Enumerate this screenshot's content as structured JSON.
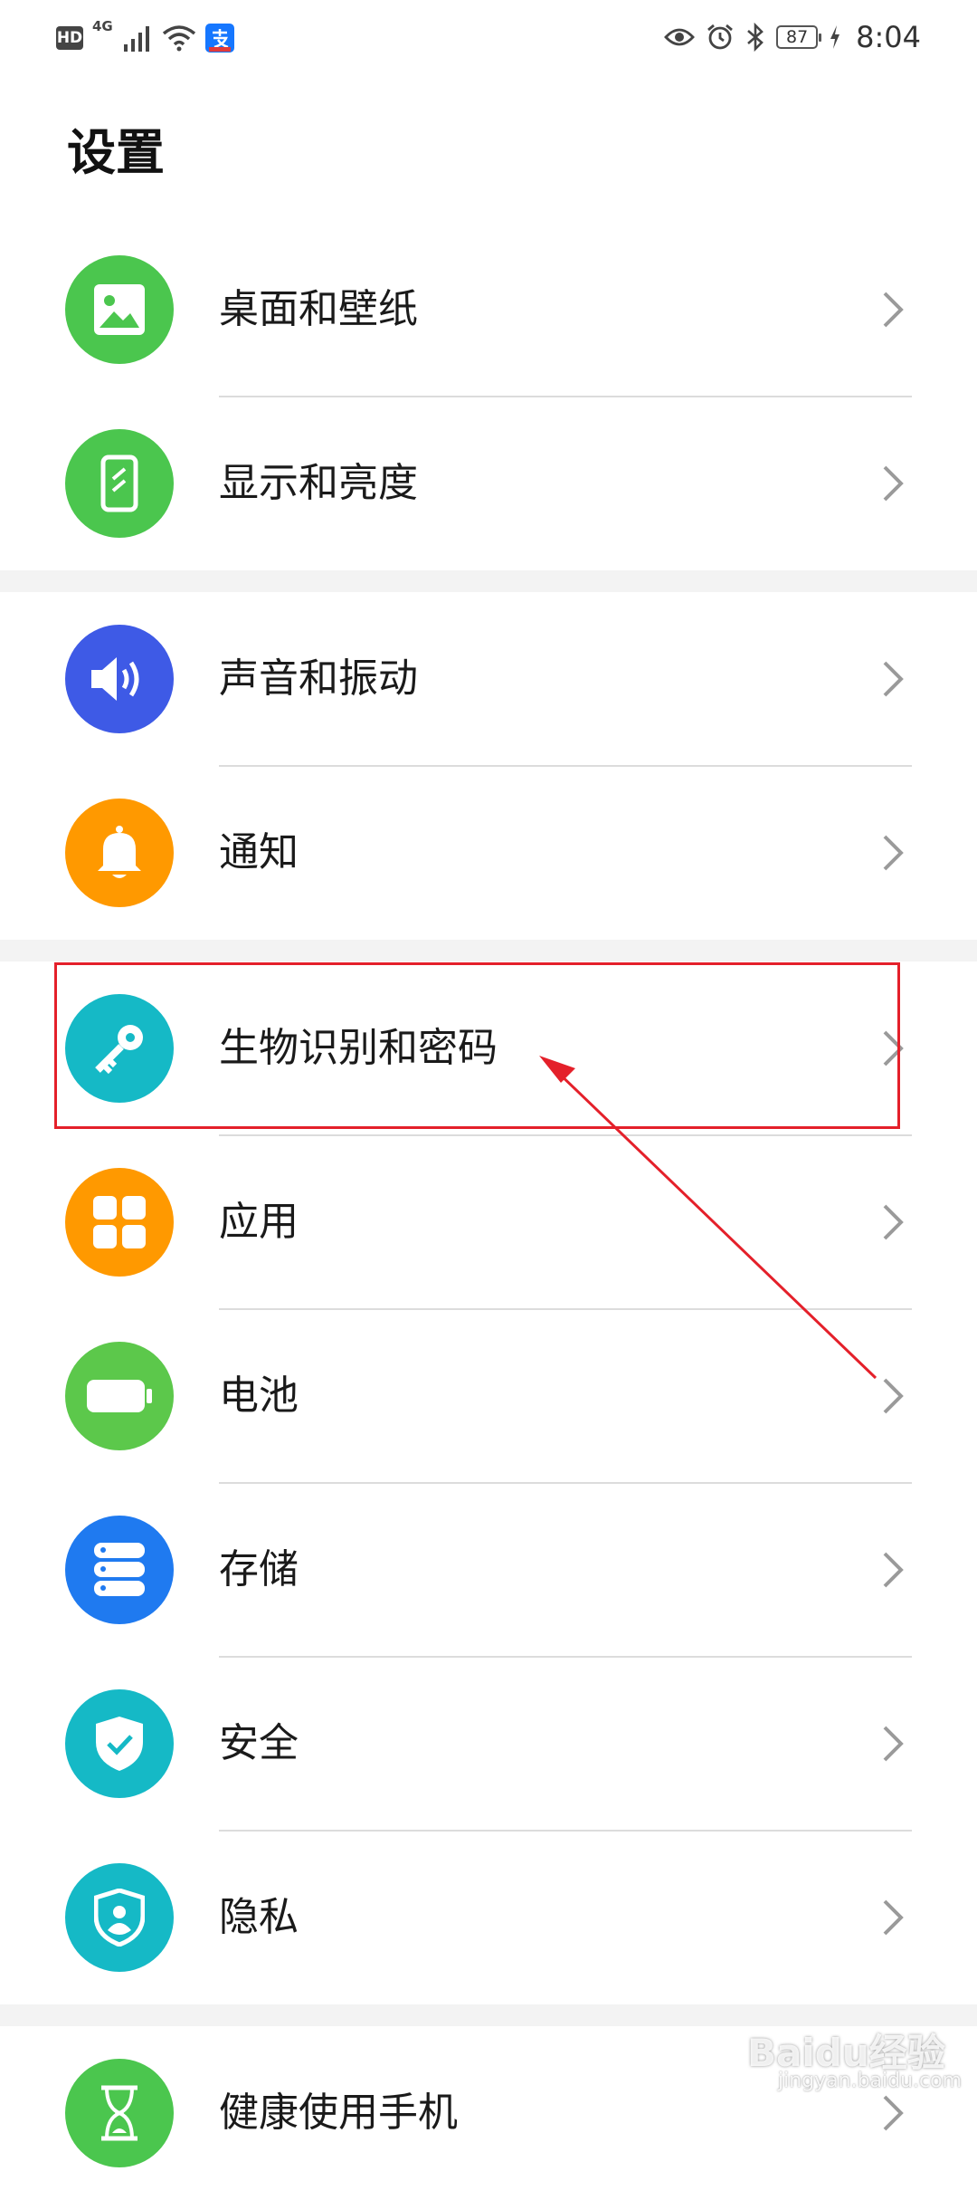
{
  "status_bar": {
    "hd": "HD",
    "network": "4G",
    "battery": "87",
    "time": "8:04"
  },
  "page_title": "设置",
  "items": [
    {
      "label": "桌面和壁纸",
      "icon": "wallpaper-icon",
      "color": "#4bc64e"
    },
    {
      "label": "显示和亮度",
      "icon": "display-icon",
      "color": "#4bc64e"
    },
    {
      "label": "声音和振动",
      "icon": "sound-icon",
      "color": "#3e5ae6"
    },
    {
      "label": "通知",
      "icon": "bell-icon",
      "color": "#ff9900"
    },
    {
      "label": "生物识别和密码",
      "icon": "key-icon",
      "color": "#15b9c6"
    },
    {
      "label": "应用",
      "icon": "apps-icon",
      "color": "#ff9900"
    },
    {
      "label": "电池",
      "icon": "battery-icon",
      "color": "#5cc84b"
    },
    {
      "label": "存储",
      "icon": "storage-icon",
      "color": "#1f7af0"
    },
    {
      "label": "安全",
      "icon": "shield-check-icon",
      "color": "#15b9c6"
    },
    {
      "label": "隐私",
      "icon": "privacy-icon",
      "color": "#15b9c6"
    },
    {
      "label": "健康使用手机",
      "icon": "hourglass-icon",
      "color": "#4bc64e"
    }
  ],
  "watermark": {
    "text": "Baidu经验",
    "sub": "jingyan.baidu.com"
  }
}
